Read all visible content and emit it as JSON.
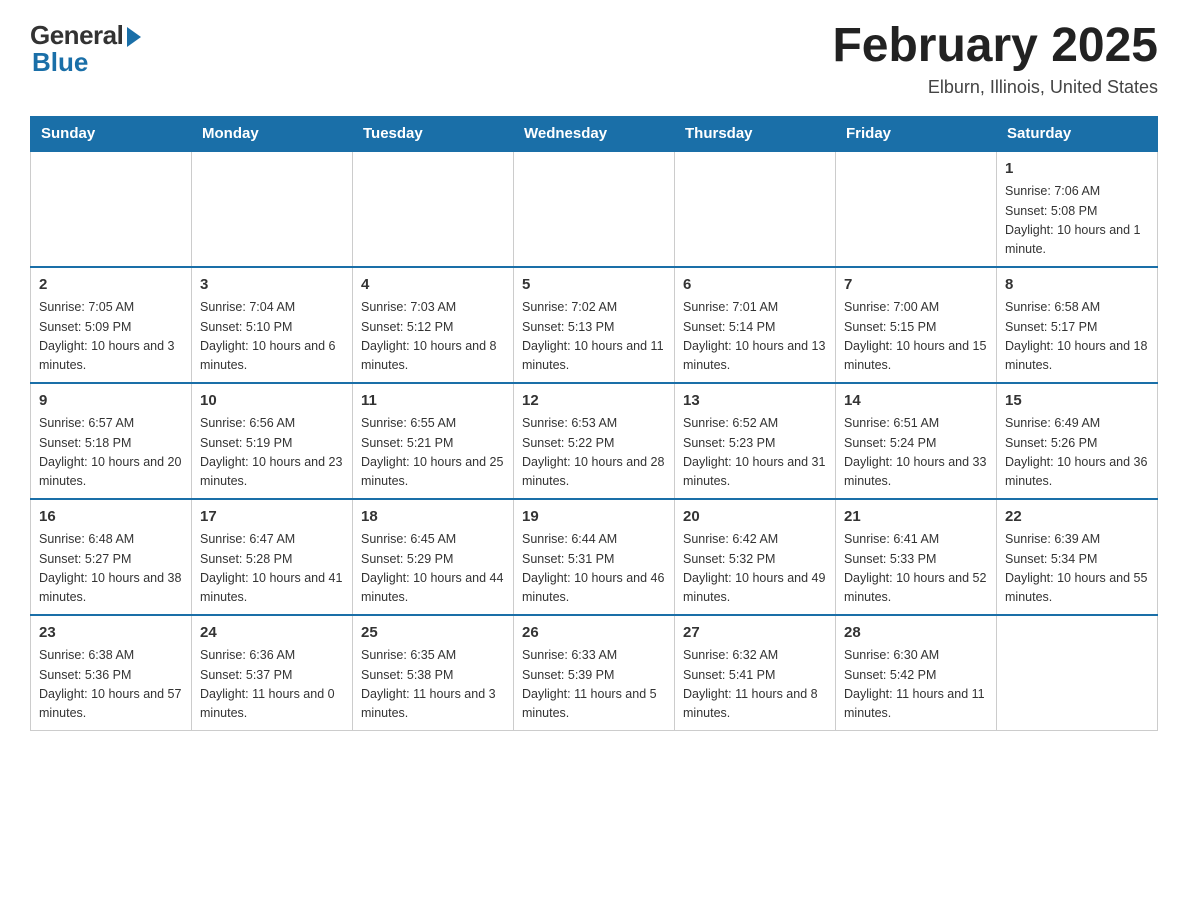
{
  "logo": {
    "general": "General",
    "blue": "Blue"
  },
  "title": "February 2025",
  "location": "Elburn, Illinois, United States",
  "weekdays": [
    "Sunday",
    "Monday",
    "Tuesday",
    "Wednesday",
    "Thursday",
    "Friday",
    "Saturday"
  ],
  "weeks": [
    [
      {
        "day": "",
        "info": ""
      },
      {
        "day": "",
        "info": ""
      },
      {
        "day": "",
        "info": ""
      },
      {
        "day": "",
        "info": ""
      },
      {
        "day": "",
        "info": ""
      },
      {
        "day": "",
        "info": ""
      },
      {
        "day": "1",
        "info": "Sunrise: 7:06 AM\nSunset: 5:08 PM\nDaylight: 10 hours and 1 minute."
      }
    ],
    [
      {
        "day": "2",
        "info": "Sunrise: 7:05 AM\nSunset: 5:09 PM\nDaylight: 10 hours and 3 minutes."
      },
      {
        "day": "3",
        "info": "Sunrise: 7:04 AM\nSunset: 5:10 PM\nDaylight: 10 hours and 6 minutes."
      },
      {
        "day": "4",
        "info": "Sunrise: 7:03 AM\nSunset: 5:12 PM\nDaylight: 10 hours and 8 minutes."
      },
      {
        "day": "5",
        "info": "Sunrise: 7:02 AM\nSunset: 5:13 PM\nDaylight: 10 hours and 11 minutes."
      },
      {
        "day": "6",
        "info": "Sunrise: 7:01 AM\nSunset: 5:14 PM\nDaylight: 10 hours and 13 minutes."
      },
      {
        "day": "7",
        "info": "Sunrise: 7:00 AM\nSunset: 5:15 PM\nDaylight: 10 hours and 15 minutes."
      },
      {
        "day": "8",
        "info": "Sunrise: 6:58 AM\nSunset: 5:17 PM\nDaylight: 10 hours and 18 minutes."
      }
    ],
    [
      {
        "day": "9",
        "info": "Sunrise: 6:57 AM\nSunset: 5:18 PM\nDaylight: 10 hours and 20 minutes."
      },
      {
        "day": "10",
        "info": "Sunrise: 6:56 AM\nSunset: 5:19 PM\nDaylight: 10 hours and 23 minutes."
      },
      {
        "day": "11",
        "info": "Sunrise: 6:55 AM\nSunset: 5:21 PM\nDaylight: 10 hours and 25 minutes."
      },
      {
        "day": "12",
        "info": "Sunrise: 6:53 AM\nSunset: 5:22 PM\nDaylight: 10 hours and 28 minutes."
      },
      {
        "day": "13",
        "info": "Sunrise: 6:52 AM\nSunset: 5:23 PM\nDaylight: 10 hours and 31 minutes."
      },
      {
        "day": "14",
        "info": "Sunrise: 6:51 AM\nSunset: 5:24 PM\nDaylight: 10 hours and 33 minutes."
      },
      {
        "day": "15",
        "info": "Sunrise: 6:49 AM\nSunset: 5:26 PM\nDaylight: 10 hours and 36 minutes."
      }
    ],
    [
      {
        "day": "16",
        "info": "Sunrise: 6:48 AM\nSunset: 5:27 PM\nDaylight: 10 hours and 38 minutes."
      },
      {
        "day": "17",
        "info": "Sunrise: 6:47 AM\nSunset: 5:28 PM\nDaylight: 10 hours and 41 minutes."
      },
      {
        "day": "18",
        "info": "Sunrise: 6:45 AM\nSunset: 5:29 PM\nDaylight: 10 hours and 44 minutes."
      },
      {
        "day": "19",
        "info": "Sunrise: 6:44 AM\nSunset: 5:31 PM\nDaylight: 10 hours and 46 minutes."
      },
      {
        "day": "20",
        "info": "Sunrise: 6:42 AM\nSunset: 5:32 PM\nDaylight: 10 hours and 49 minutes."
      },
      {
        "day": "21",
        "info": "Sunrise: 6:41 AM\nSunset: 5:33 PM\nDaylight: 10 hours and 52 minutes."
      },
      {
        "day": "22",
        "info": "Sunrise: 6:39 AM\nSunset: 5:34 PM\nDaylight: 10 hours and 55 minutes."
      }
    ],
    [
      {
        "day": "23",
        "info": "Sunrise: 6:38 AM\nSunset: 5:36 PM\nDaylight: 10 hours and 57 minutes."
      },
      {
        "day": "24",
        "info": "Sunrise: 6:36 AM\nSunset: 5:37 PM\nDaylight: 11 hours and 0 minutes."
      },
      {
        "day": "25",
        "info": "Sunrise: 6:35 AM\nSunset: 5:38 PM\nDaylight: 11 hours and 3 minutes."
      },
      {
        "day": "26",
        "info": "Sunrise: 6:33 AM\nSunset: 5:39 PM\nDaylight: 11 hours and 5 minutes."
      },
      {
        "day": "27",
        "info": "Sunrise: 6:32 AM\nSunset: 5:41 PM\nDaylight: 11 hours and 8 minutes."
      },
      {
        "day": "28",
        "info": "Sunrise: 6:30 AM\nSunset: 5:42 PM\nDaylight: 11 hours and 11 minutes."
      },
      {
        "day": "",
        "info": ""
      }
    ]
  ]
}
